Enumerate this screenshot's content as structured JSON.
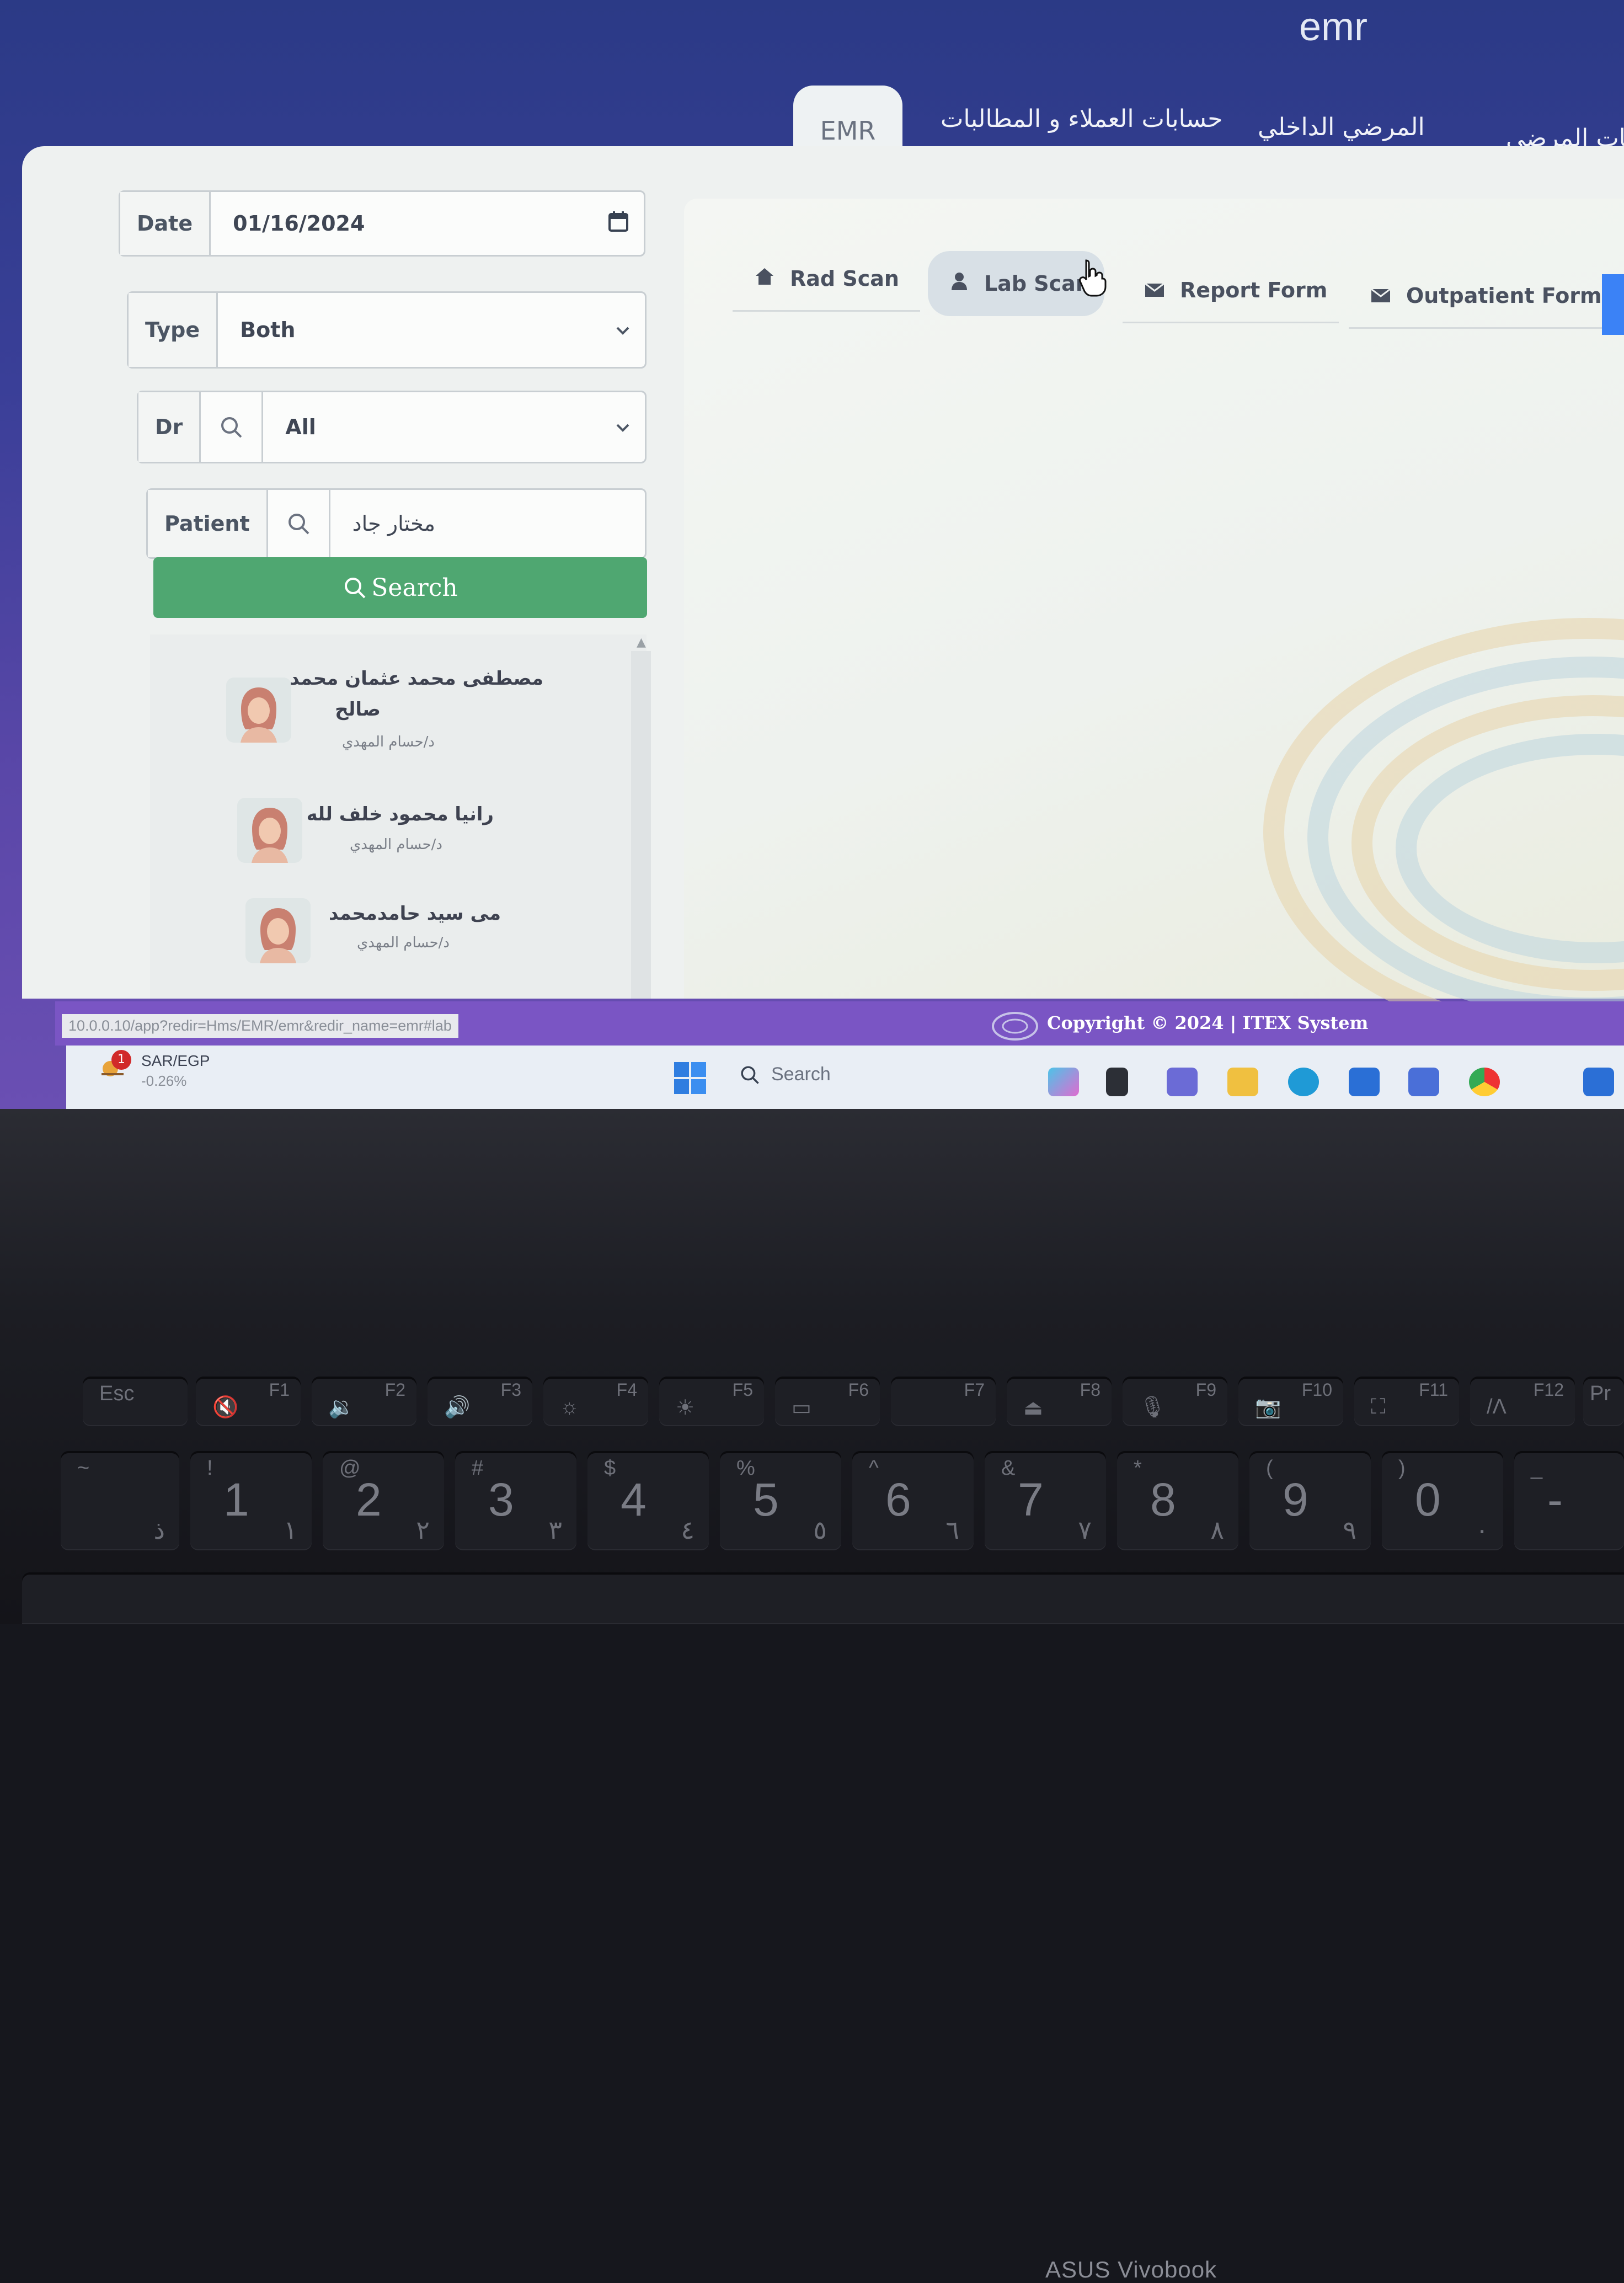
{
  "app": {
    "title": "emr"
  },
  "top_tabs": [
    {
      "label": "EMR",
      "active": true
    },
    {
      "label": "حسابات العملاء و المطالبات",
      "active": false
    },
    {
      "label": "المرضي الداخلي",
      "active": false
    },
    {
      "label": "ابات المرضي",
      "active": false
    }
  ],
  "filters": {
    "date_label": "Date",
    "date_value": "01/16/2024",
    "type_label": "Type",
    "type_value": "Both",
    "dr_label": "Dr",
    "dr_value": "All",
    "patient_label": "Patient",
    "patient_value": "مختار جاد",
    "search_label": "Search"
  },
  "patients": [
    {
      "name_line1": "مصطفى محمد عثمان محمد",
      "name_line2": "صالح",
      "doctor": "د/حسام المهدي"
    },
    {
      "name_line1": "رانيا محمود خلف لله",
      "name_line2": "",
      "doctor": "د/حسام المهدي"
    },
    {
      "name_line1": "مى سيد حامدمحمد",
      "name_line2": "",
      "doctor": "د/حسام المهدي"
    }
  ],
  "sub_tabs": [
    {
      "label": "Rad Scan",
      "icon": "home-icon",
      "active": false
    },
    {
      "label": "Lab Scan",
      "icon": "user-icon",
      "active": true
    },
    {
      "label": "Report Form",
      "icon": "envelope-icon",
      "active": false
    },
    {
      "label": "Outpatient Form",
      "icon": "envelope-icon",
      "active": false
    }
  ],
  "status": {
    "url": "10.0.0.10/app?redir=Hms/EMR/emr&redir_name=emr#lab",
    "copyright": "Copyright © 2024 | ITEX System"
  },
  "taskbar": {
    "notification_count": "1",
    "currency_pair": "SAR/EGP",
    "currency_change": "-0.26%",
    "search_placeholder": "Search"
  },
  "device": {
    "brand": "ASUS Vivobook",
    "fkeys": [
      "Esc",
      "F1",
      "F2",
      "F3",
      "F4",
      "F5",
      "F6",
      "F7",
      "F8",
      "F9",
      "F10",
      "F11",
      "F12",
      "Pr"
    ],
    "number_keys": [
      {
        "sym": "~",
        "num": "",
        "ar": "ذ"
      },
      {
        "sym": "!",
        "num": "1",
        "ar": "١"
      },
      {
        "sym": "@",
        "num": "2",
        "ar": "٢"
      },
      {
        "sym": "#",
        "num": "3",
        "ar": "٣"
      },
      {
        "sym": "$",
        "num": "4",
        "ar": "٤"
      },
      {
        "sym": "%",
        "num": "5",
        "ar": "٥"
      },
      {
        "sym": "^",
        "num": "6",
        "ar": "٦"
      },
      {
        "sym": "&",
        "num": "7",
        "ar": "٧"
      },
      {
        "sym": "*",
        "num": "8",
        "ar": "٨"
      },
      {
        "sym": "(",
        "num": "9",
        "ar": "٩"
      },
      {
        "sym": ")",
        "num": "0",
        "ar": "٠"
      },
      {
        "sym": "_",
        "num": "-",
        "ar": ""
      }
    ]
  },
  "colors": {
    "header_bg": "#2b3a86",
    "search_button": "#4fa771",
    "footer_bar": "#7a55c4",
    "accent_blue": "#3b82f6"
  }
}
